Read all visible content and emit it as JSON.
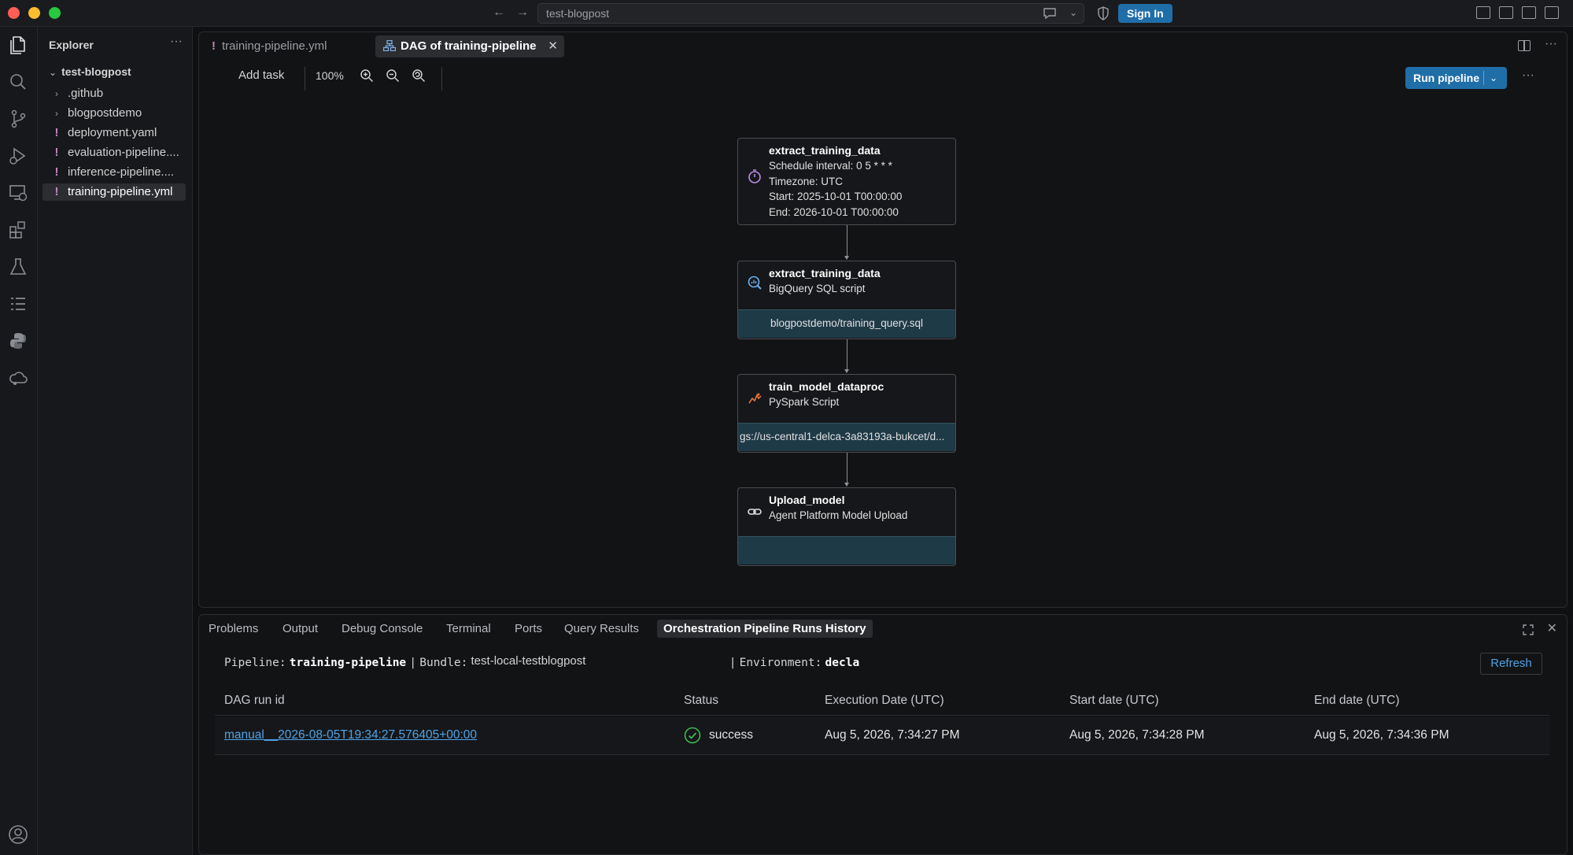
{
  "titlebar": {
    "search_text": "test-blogpost",
    "signin_label": "Sign In"
  },
  "sidebar": {
    "title": "Explorer",
    "more": "···",
    "root": "test-blogpost",
    "items": [
      {
        "label": ".github",
        "kind": "folder"
      },
      {
        "label": "blogpostdemo",
        "kind": "folder"
      },
      {
        "label": "deployment.yaml",
        "kind": "yaml"
      },
      {
        "label": "evaluation-pipeline....",
        "kind": "yaml"
      },
      {
        "label": "inference-pipeline....",
        "kind": "yaml"
      },
      {
        "label": "training-pipeline.yml",
        "kind": "yaml",
        "active": true
      }
    ]
  },
  "editor": {
    "tabs": [
      {
        "label": "training-pipeline.yml",
        "active": false
      },
      {
        "label": "DAG of training-pipeline",
        "active": true
      }
    ],
    "toolbar": {
      "add_task": "Add task",
      "zoom": "100%",
      "run_label": "Run pipeline"
    },
    "nodes": [
      {
        "title": "extract_training_data",
        "icon": "timer-icon",
        "lines": [
          "Schedule interval: 0 5 * * *",
          "Timezone: UTC",
          "Start: 2025-10-01 T00:00:00",
          "End: 2026-10-01 T00:00:00"
        ]
      },
      {
        "title": "extract_training_data",
        "icon": "bigquery-icon",
        "lines": [
          "BigQuery SQL script"
        ],
        "footer": "blogpostdemo/training_query.sql"
      },
      {
        "title": "train_model_dataproc",
        "icon": "spark-icon",
        "lines": [
          "PySpark Script"
        ],
        "footer": "gs://us-central1-delca-3a83193a-bukcet/d..."
      },
      {
        "title": "Upload_model",
        "icon": "link-icon",
        "lines": [
          "Agent Platform Model Upload"
        ],
        "footer": ""
      }
    ]
  },
  "panel": {
    "tabs": [
      "Problems",
      "Output",
      "Debug Console",
      "Terminal",
      "Ports",
      "Query Results",
      "Orchestration Pipeline Runs History"
    ],
    "pipeline_label": "Pipeline:",
    "pipeline_value": "training-pipeline",
    "sep": "|",
    "bundle_label": "Bundle:",
    "bundle_value": "test-local-testblogpost",
    "env_label": "Environment:",
    "env_value": "decla",
    "refresh_label": "Refresh",
    "columns": [
      "DAG run id",
      "Status",
      "Execution Date (UTC)",
      "Start date (UTC)",
      "End date (UTC)"
    ],
    "rows": [
      {
        "run_id": "manual__2026-08-05T19:34:27.576405+00:00",
        "status": "success",
        "execution_date": "Aug 5, 2026, 7:34:27 PM",
        "start_date": "Aug 5, 2026, 7:34:28 PM",
        "end_date": "Aug 5, 2026, 7:34:36 PM"
      }
    ]
  },
  "colors": {
    "accent": "#1f6ea8",
    "link": "#4ea3e6",
    "success": "#3fb950",
    "yaml_marker": "#c586c0"
  }
}
